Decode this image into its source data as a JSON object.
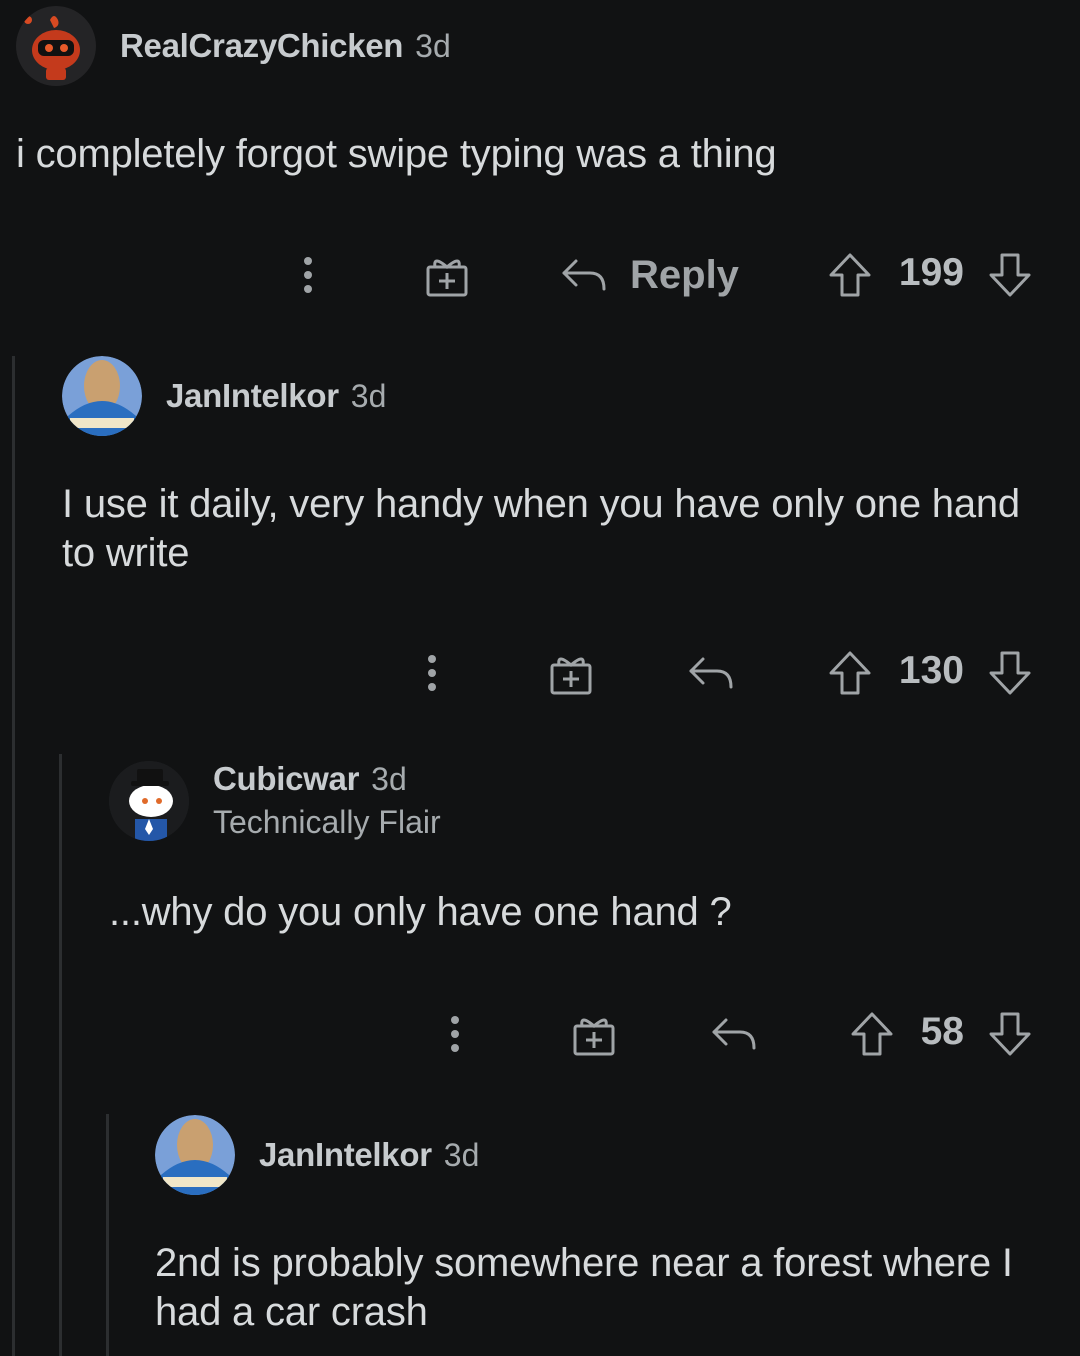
{
  "comments": [
    {
      "username": "RealCrazyChicken",
      "age": "3d",
      "body": "i completely forgot swipe typing was a thing",
      "reply_label": "Reply",
      "score": "199",
      "avatar_icon": "robot-chicken-avatar"
    },
    {
      "username": "JanIntelkor",
      "age": "3d",
      "body": "I use it daily, very handy when you have only one hand to write",
      "score": "130",
      "avatar_icon": "photo-avatar"
    },
    {
      "username": "Cubicwar",
      "age": "3d",
      "flair": "Technically Flair",
      "body": "...why do you only have one hand ?",
      "score": "58",
      "avatar_icon": "snoo-top-hat-avatar"
    },
    {
      "username": "JanIntelkor",
      "age": "3d",
      "body": "2nd is probably somewhere near a forest where I had a car crash",
      "avatar_icon": "photo-avatar"
    }
  ],
  "colors": {
    "background": "#111213",
    "text": "#d7dadc",
    "thread_line": "#2c2e30",
    "icon": "#a0a4a7"
  }
}
